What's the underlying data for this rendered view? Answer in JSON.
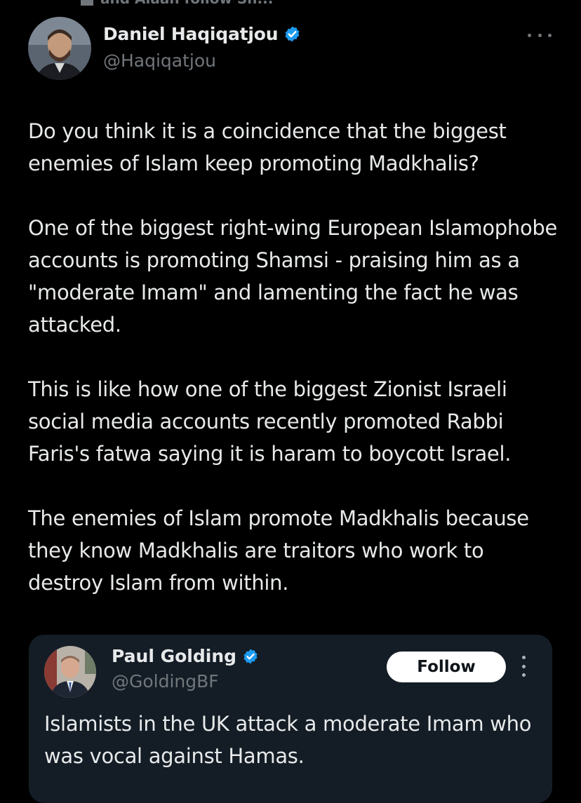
{
  "context_line": "and Alaan follow Sh...",
  "tweet": {
    "author_name": "Daniel Haqiqatjou",
    "author_handle": "@Haqiqatjou",
    "paragraphs": [
      "Do you think it is a coincidence that the biggest enemies of Islam keep promoting Madkhalis?",
      "One of the biggest right-wing European Islamophobe accounts is promoting Shamsi - praising him as a \"moderate Imam\" and lamenting the fact he was attacked.",
      "This is like how one of the biggest Zionist Israeli social media accounts recently promoted Rabbi Faris's fatwa saying it is haram to boycott Israel.",
      "The enemies of Islam promote Madkhalis because they know Madkhalis are traitors who work to destroy Islam from within."
    ],
    "verified_icon": "verified-badge-icon",
    "more_icon": "more-horizontal-icon"
  },
  "quoted_tweet": {
    "author_name": "Paul Golding",
    "author_handle": "@GoldingBF",
    "follow_label": "Follow",
    "text": "Islamists in the UK attack a moderate Imam who was vocal against Hamas.",
    "verified_icon": "verified-badge-icon",
    "more_icon": "more-vertical-icon"
  },
  "colors": {
    "background": "#000000",
    "card_background": "#141d26",
    "text_primary": "#e7e9ea",
    "text_secondary": "#71767b",
    "verified_blue": "#1d9bf0",
    "follow_button_bg": "#ffffff"
  }
}
